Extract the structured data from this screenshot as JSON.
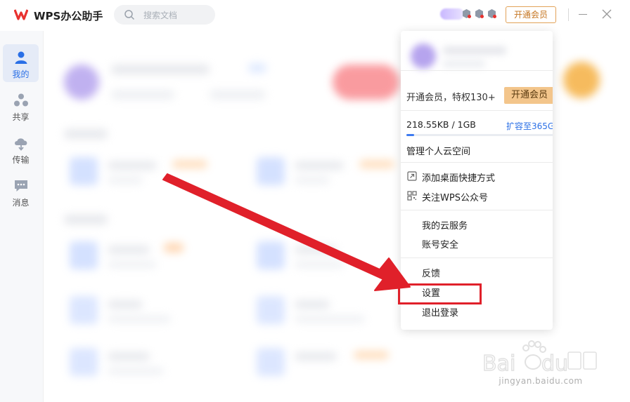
{
  "app": {
    "title": "WPS办公助手",
    "search_placeholder": "搜索文档",
    "vip_button": "开通会员",
    "brand_color": "#e8322f",
    "accent_color": "#2a6fe6"
  },
  "nav": {
    "items": [
      {
        "label": "我的",
        "icon": "user-icon",
        "active": true
      },
      {
        "label": "共享",
        "icon": "share-icon",
        "active": false
      },
      {
        "label": "传输",
        "icon": "cloud-transfer-icon",
        "active": false
      },
      {
        "label": "消息",
        "icon": "message-icon",
        "active": false
      }
    ]
  },
  "menu": {
    "promo": "开通会员，特权130+",
    "vip_button": "开通会员",
    "storage": "218.55KB / 1GB",
    "storage_used_fraction": 0.05,
    "expand": "扩容至365G",
    "manage": "管理个人云空间",
    "shortcut": "添加桌面快捷方式",
    "follow": "关注WPS公众号",
    "cloud_service": "我的云服务",
    "account_security": "账号安全",
    "feedback": "反馈",
    "settings": "设置",
    "logout": "退出登录"
  },
  "watermark": {
    "url": "jingyan.baidu.com"
  }
}
